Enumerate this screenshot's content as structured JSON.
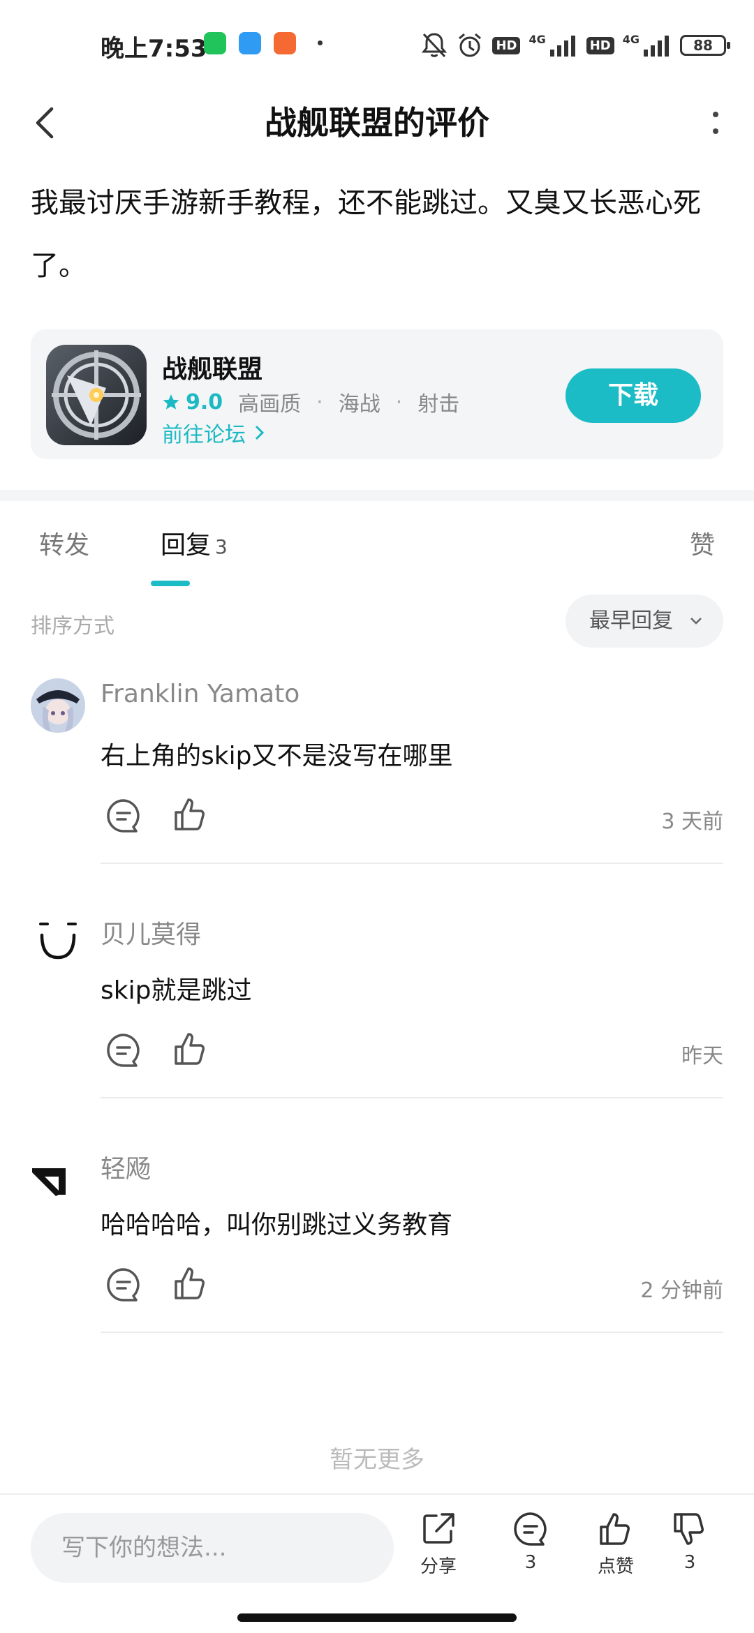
{
  "status_bar": {
    "time": "晚上7:53",
    "hd1": "HD",
    "net1": "4G",
    "hd2": "HD",
    "net2": "4G",
    "battery": "88"
  },
  "header": {
    "title": "战舰联盟的评价"
  },
  "review": {
    "text": "我最讨厌手游新手教程，还不能跳过。又臭又长恶心死了。"
  },
  "app_card": {
    "name": "战舰联盟",
    "rating": "9.0",
    "tags": [
      "高画质",
      "海战",
      "射击"
    ],
    "forum_link": "前往论坛",
    "download_label": "下载",
    "accent_color": "#1bbcc6"
  },
  "tabs": {
    "forward": "转发",
    "reply": "回复",
    "reply_count": "3",
    "like": "赞"
  },
  "sort": {
    "label": "排序方式",
    "value": "最早回复"
  },
  "replies": [
    {
      "user": "Franklin Yamato",
      "text": "右上角的skip又不是没写在哪里",
      "time": "3 天前"
    },
    {
      "user": "贝儿莫得",
      "text": "skip就是跳过",
      "time": "昨天"
    },
    {
      "user": "轻飏",
      "text": "哈哈哈哈，叫你别跳过义务教育",
      "time": "2 分钟前"
    }
  ],
  "footer_note": "暂无更多",
  "bottom_bar": {
    "input_placeholder": "写下你的想法...",
    "share_label": "分享",
    "comment_count": "3",
    "like_label": "点赞",
    "dislike_count": "3"
  }
}
